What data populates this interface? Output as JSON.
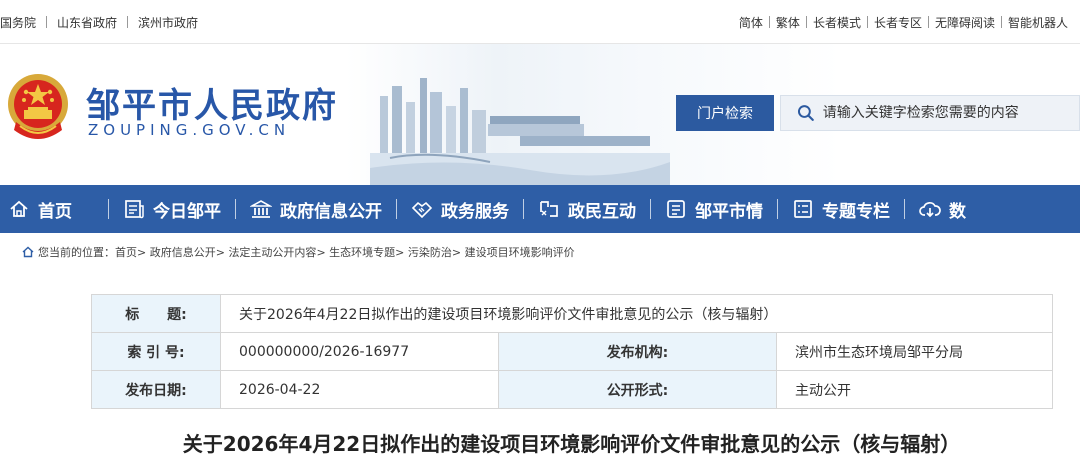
{
  "topbar": {
    "left_links": [
      "国务院",
      "山东省政府",
      "滨州市政府"
    ],
    "right_links": [
      "简体",
      "繁体",
      "长者模式",
      "长者专区",
      "无障碍阅读",
      "智能机器人"
    ]
  },
  "header": {
    "site_title": "邹平市人民政府",
    "site_domain": "ZOUPING.GOV.CN",
    "search_button": "门户检索",
    "search_placeholder": "请输入关键字检索您需要的内容"
  },
  "nav": {
    "items": [
      {
        "label": "首页",
        "icon": "home-icon"
      },
      {
        "label": "今日邹平",
        "icon": "newspaper-icon"
      },
      {
        "label": "政府信息公开",
        "icon": "government-building-icon"
      },
      {
        "label": "政务服务",
        "icon": "handshake-icon"
      },
      {
        "label": "政民互动",
        "icon": "interaction-icon"
      },
      {
        "label": "邹平市情",
        "icon": "info-card-icon"
      },
      {
        "label": "专题专栏",
        "icon": "list-icon"
      },
      {
        "label": "数",
        "icon": "cloud-download-icon"
      }
    ]
  },
  "breadcrumb": {
    "prefix": "您当前的位置：",
    "items": [
      "首页",
      "政府信息公开",
      "法定主动公开内容",
      "生态环境专题",
      "污染防治",
      "建设项目环境影响评价"
    ],
    "separator": ">"
  },
  "info_table": {
    "title_label": "标　　题:",
    "title_value": "关于2026年4月22日拟作出的建设项目环境影响评价文件审批意见的公示（核与辐射）",
    "index_label": "索 引 号:",
    "index_value": "000000000/2026-16977",
    "publisher_label": "发布机构:",
    "publisher_value": "滨州市生态环境局邹平分局",
    "date_label": "发布日期:",
    "date_value": "2026-04-22",
    "form_label": "公开形式:",
    "form_value": "主动公开"
  },
  "document": {
    "title": "关于2026年4月22日拟作出的建设项目环境影响评价文件审批意见的公示（核与辐射）"
  },
  "colors": {
    "brand_blue": "#2e5ea6",
    "title_blue": "#2857a8",
    "label_bg": "#eaf4fb"
  }
}
